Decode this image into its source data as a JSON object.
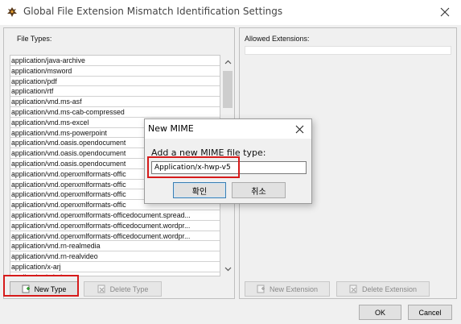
{
  "window": {
    "title": "Global File Extension Mismatch Identification Settings"
  },
  "left_panel": {
    "label": "File Types:",
    "items": [
      "application/java-archive",
      "application/msword",
      "application/pdf",
      "application/rtf",
      "application/vnd.ms-asf",
      "application/vnd.ms-cab-compressed",
      "application/vnd.ms-excel",
      "application/vnd.ms-powerpoint",
      "application/vnd.oasis.opendocument",
      "application/vnd.oasis.opendocument",
      "application/vnd.oasis.opendocument",
      "application/vnd.openxmlformats-offic",
      "application/vnd.openxmlformats-offic",
      "application/vnd.openxmlformats-offic",
      "application/vnd.openxmlformats-offic",
      "application/vnd.openxmlformats-officedocument.spread...",
      "application/vnd.openxmlformats-officedocument.wordpr...",
      "application/vnd.openxmlformats-officedocument.wordpr...",
      "application/vnd.rn-realmedia",
      "application/vnd.rn-realvideo",
      "application/x-arj",
      "application/x-bzip"
    ],
    "new_type_label": "New Type",
    "delete_type_label": "Delete Type"
  },
  "right_panel": {
    "label": "Allowed Extensions:",
    "new_extension_label": "New Extension",
    "delete_extension_label": "Delete Extension"
  },
  "footer": {
    "ok_label": "OK",
    "cancel_label": "Cancel"
  },
  "dialog": {
    "title": "New MIME",
    "prompt": "Add a new MIME file type:",
    "input_value": "Application/x-hwp-v5",
    "confirm_label": "확인",
    "cancel_label": "취소"
  },
  "colors": {
    "highlight": "#d61b1b",
    "background": "#f0f0f0"
  },
  "icons": {
    "app": "gecko-icon",
    "close": "close-icon",
    "new": "new-item-icon",
    "delete": "delete-item-icon"
  }
}
